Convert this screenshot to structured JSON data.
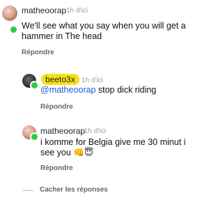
{
  "comments": [
    {
      "username": "matheoorap",
      "time": "1h d'ici",
      "text": "We'll see what you say when you will get a hammer in The head",
      "reply_label": "Répondre"
    },
    {
      "username": "beeto3x",
      "time": "1h d'ici",
      "mention": "@matheoorap",
      "text": " stop dick riding",
      "reply_label": "Répondre"
    },
    {
      "username": "matheoorap",
      "time": "1h d'ici",
      "text": "i komme for Belgia give me 30 minut i see you 👊😇",
      "reply_label": "Répondre"
    }
  ],
  "hide_replies_label": "Cacher les réponses"
}
